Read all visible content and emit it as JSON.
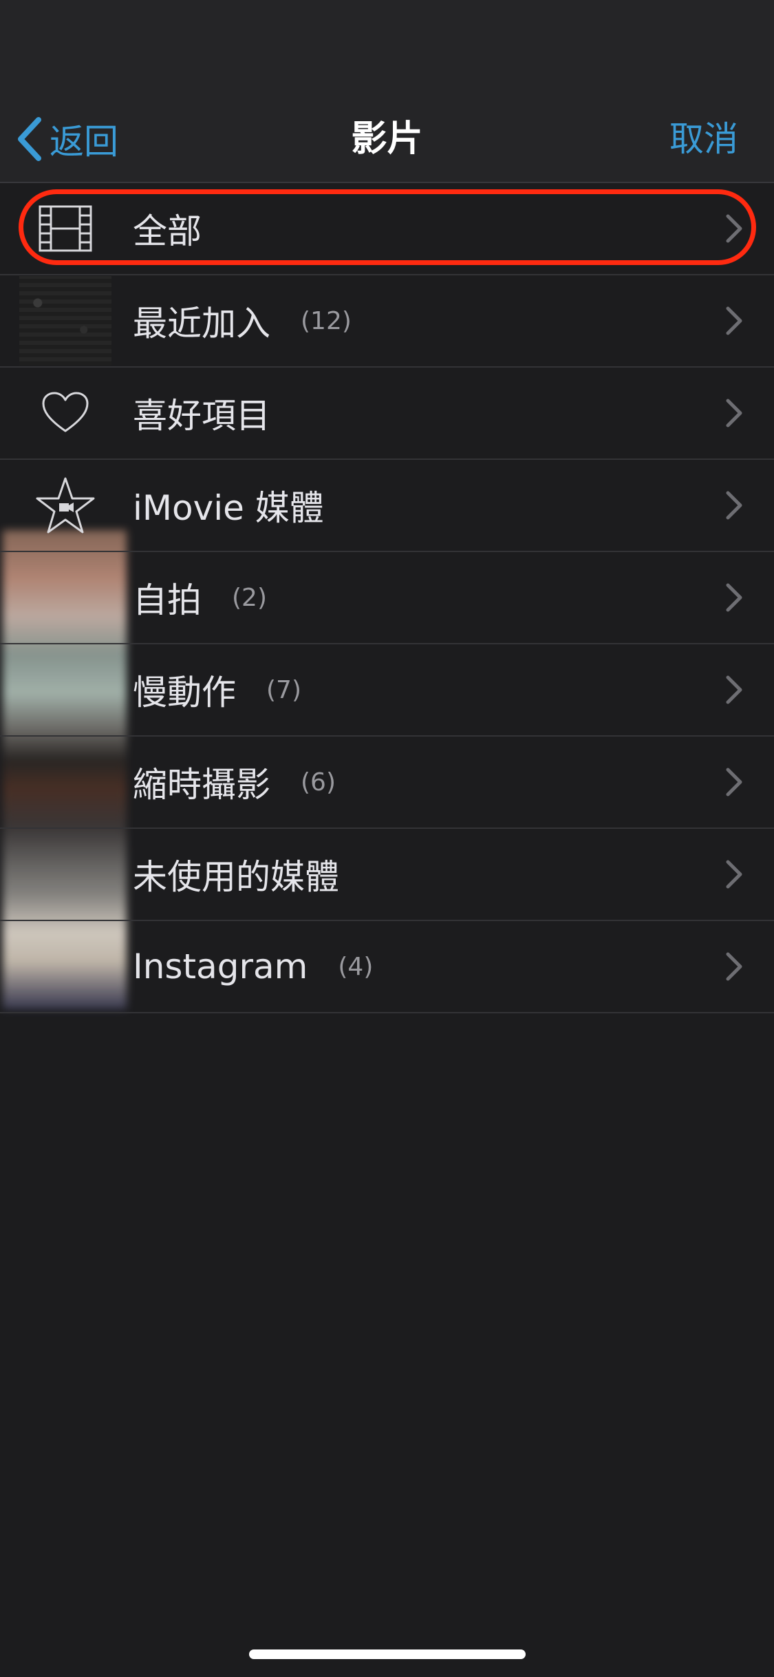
{
  "navbar": {
    "back_label": "返回",
    "title": "影片",
    "cancel_label": "取消"
  },
  "colors": {
    "accent": "#3a9bd6",
    "highlight": "#ff2a10",
    "background": "#1c1c1e"
  },
  "albums": [
    {
      "label": "全部",
      "count": "",
      "icon": "film-icon"
    },
    {
      "label": "最近加入",
      "count": "(12)",
      "icon": "thumbnail"
    },
    {
      "label": "喜好項目",
      "count": "",
      "icon": "heart-icon"
    },
    {
      "label": "iMovie 媒體",
      "count": "",
      "icon": "imovie-star-icon"
    },
    {
      "label": "自拍",
      "count": "(2)",
      "icon": "thumbnail"
    },
    {
      "label": "慢動作",
      "count": "(7)",
      "icon": "thumbnail"
    },
    {
      "label": "縮時攝影",
      "count": "(6)",
      "icon": "thumbnail"
    },
    {
      "label": "未使用的媒體",
      "count": "",
      "icon": "thumbnail"
    },
    {
      "label": "Instagram",
      "count": "(4)",
      "icon": "thumbnail"
    }
  ]
}
